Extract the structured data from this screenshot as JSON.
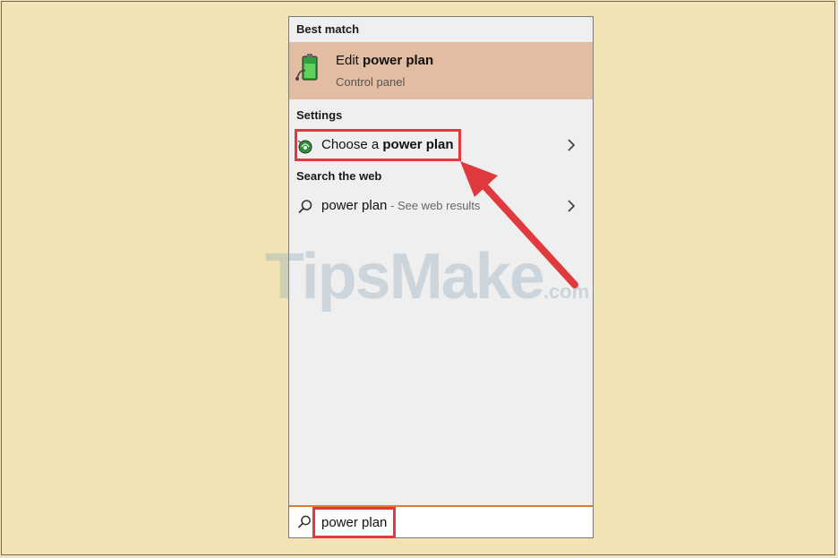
{
  "best_match": {
    "header": "Best match",
    "title_prefix": "Edit ",
    "title_bold": "power plan",
    "subtitle": "Control panel",
    "icon": "battery-icon"
  },
  "settings": {
    "header": "Settings",
    "item_prefix": "Choose a ",
    "item_bold": "power plan",
    "icon": "power-options-icon"
  },
  "web": {
    "header": "Search the web",
    "query": "power plan",
    "suffix": " - See web results",
    "icon": "search-icon"
  },
  "search_box": {
    "value": "power plan",
    "icon": "search-icon"
  },
  "watermark": {
    "text": "TipsMake",
    "domain": ".com"
  },
  "colors": {
    "background": "#f1e3b3",
    "best_match_highlight": "#e2bda1",
    "annotation_red": "#e0393e",
    "search_accent": "#e37a2a"
  }
}
